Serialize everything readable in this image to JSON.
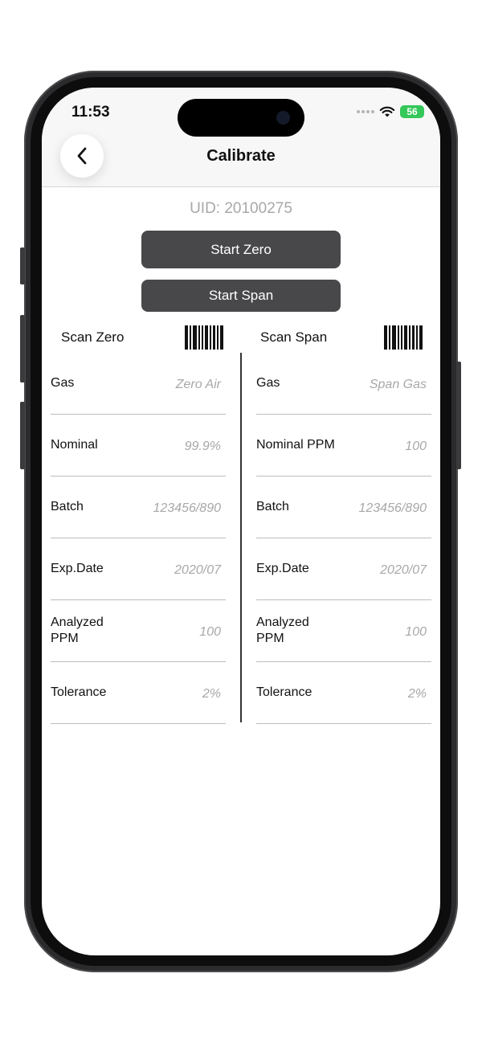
{
  "status": {
    "time": "11:53",
    "battery": "56"
  },
  "header": {
    "title": "Calibrate"
  },
  "uid": "UID: 20100275",
  "buttons": {
    "start_zero": "Start Zero",
    "start_span": "Start Span"
  },
  "scan": {
    "zero_label": "Scan Zero",
    "span_label": "Scan Span"
  },
  "zero_fields": [
    {
      "label": "Gas",
      "value": "Zero Air"
    },
    {
      "label": "Nominal",
      "value": "99.9%"
    },
    {
      "label": "Batch",
      "value": "123456/890"
    },
    {
      "label": "Exp.Date",
      "value": "2020/07"
    },
    {
      "label": "Analyzed PPM",
      "value": "100"
    },
    {
      "label": "Tolerance",
      "value": "2%"
    }
  ],
  "span_fields": [
    {
      "label": "Gas",
      "value": "Span Gas"
    },
    {
      "label": "Nominal PPM",
      "value": "100"
    },
    {
      "label": "Batch",
      "value": "123456/890"
    },
    {
      "label": "Exp.Date",
      "value": "2020/07"
    },
    {
      "label": "Analyzed PPM",
      "value": "100"
    },
    {
      "label": "Tolerance",
      "value": "2%"
    }
  ],
  "colors": {
    "button_bg": "#48484a",
    "battery": "#34c759",
    "value_text": "#a8a8a8"
  },
  "icons": [
    "chevron-left-icon",
    "wifi-icon",
    "battery-icon",
    "barcode-icon"
  ]
}
